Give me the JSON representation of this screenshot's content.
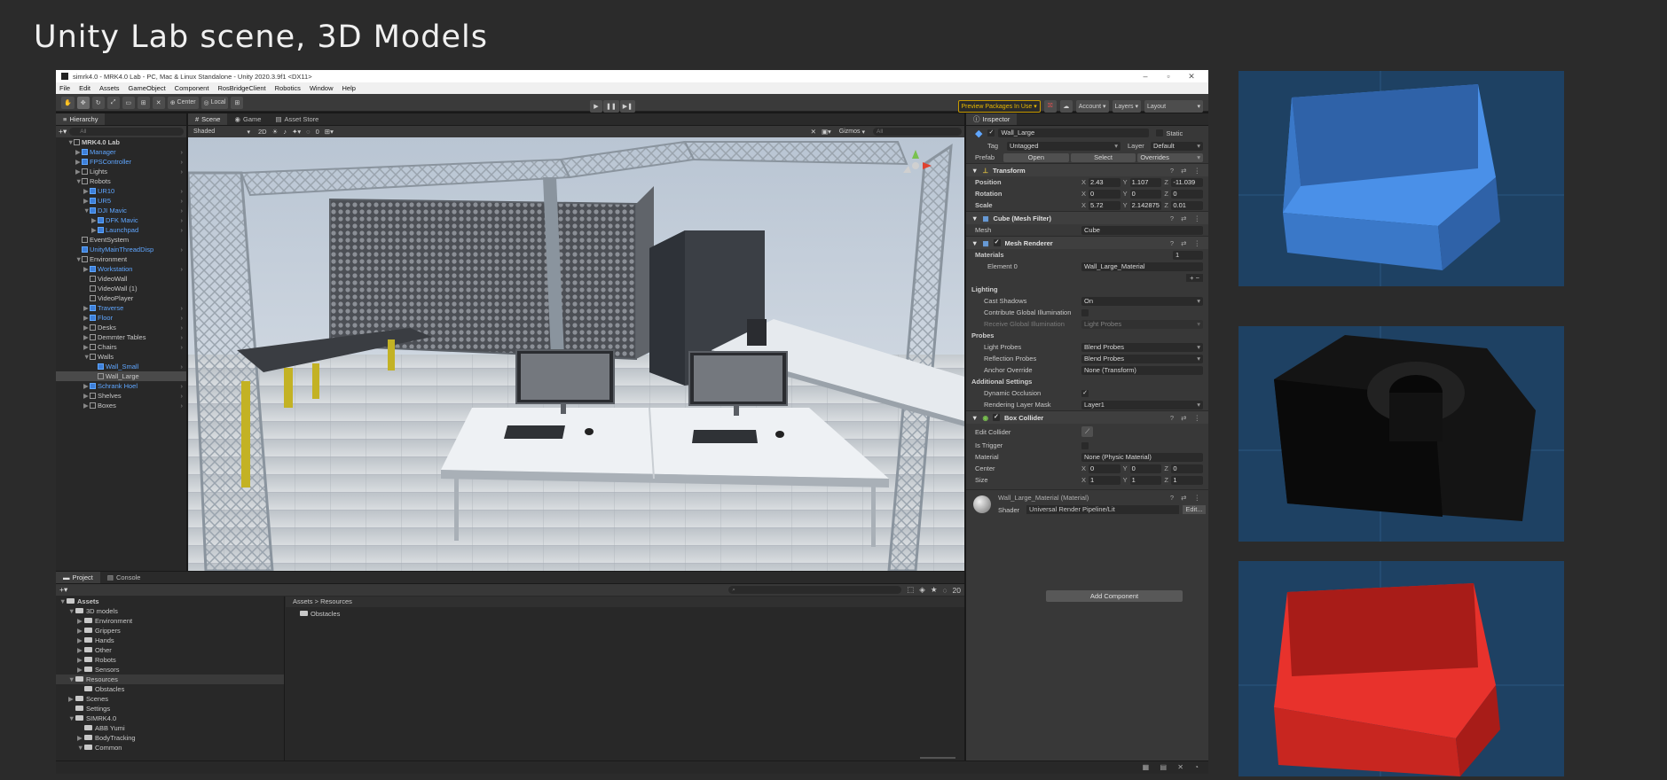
{
  "slide": {
    "title": "Unity Lab scene, 3D Models"
  },
  "unity": {
    "window_title": "simrk4.0 - MRK4.0 Lab - PC, Mac & Linux Standalone - Unity 2020.3.9f1 <DX11>",
    "menu": [
      "File",
      "Edit",
      "Assets",
      "GameObject",
      "Component",
      "RosBridgeClient",
      "Robotics",
      "Window",
      "Help"
    ],
    "toolbar": {
      "pivot": "Center",
      "space": "Local",
      "preview_packages": "Preview Packages In Use",
      "account": "Account",
      "layers": "Layers",
      "layout": "Layout"
    },
    "hierarchy": {
      "tab": "Hierarchy",
      "search_placeholder": "All",
      "items": [
        {
          "label": "MRK4.0 Lab",
          "indent": 1,
          "arrow": "▼",
          "blue": false,
          "bold": true
        },
        {
          "label": "Manager",
          "indent": 2,
          "arrow": "▶",
          "blue": true
        },
        {
          "label": "FPSController",
          "indent": 2,
          "arrow": "▶",
          "blue": true
        },
        {
          "label": "Lights",
          "indent": 2,
          "arrow": "▶",
          "blue": false
        },
        {
          "label": "Robots",
          "indent": 2,
          "arrow": "▼",
          "blue": false
        },
        {
          "label": "UR10",
          "indent": 3,
          "arrow": "▶",
          "blue": true
        },
        {
          "label": "UR5",
          "indent": 3,
          "arrow": "▶",
          "blue": true
        },
        {
          "label": "DJI Mavic",
          "indent": 3,
          "arrow": "▼",
          "blue": true
        },
        {
          "label": "DFK Mavic",
          "indent": 4,
          "arrow": "▶",
          "blue": true
        },
        {
          "label": "Launchpad",
          "indent": 4,
          "arrow": "▶",
          "blue": true
        },
        {
          "label": "EventSystem",
          "indent": 2,
          "arrow": "",
          "blue": false
        },
        {
          "label": "UnityMainThreadDisp",
          "indent": 2,
          "arrow": "",
          "blue": true
        },
        {
          "label": "Environment",
          "indent": 2,
          "arrow": "▼",
          "blue": false
        },
        {
          "label": "Workstation",
          "indent": 3,
          "arrow": "▶",
          "blue": true
        },
        {
          "label": "VideoWall",
          "indent": 3,
          "arrow": "",
          "blue": false
        },
        {
          "label": "VideoWall (1)",
          "indent": 3,
          "arrow": "",
          "blue": false
        },
        {
          "label": "VideoPlayer",
          "indent": 3,
          "arrow": "",
          "blue": false
        },
        {
          "label": "Traverse",
          "indent": 3,
          "arrow": "▶",
          "blue": true
        },
        {
          "label": "Floor",
          "indent": 3,
          "arrow": "▶",
          "blue": true
        },
        {
          "label": "Desks",
          "indent": 3,
          "arrow": "▶",
          "blue": false
        },
        {
          "label": "Demmter Tables",
          "indent": 3,
          "arrow": "▶",
          "blue": false
        },
        {
          "label": "Chairs",
          "indent": 3,
          "arrow": "▶",
          "blue": false
        },
        {
          "label": "Walls",
          "indent": 3,
          "arrow": "▼",
          "blue": false
        },
        {
          "label": "Wall_Small",
          "indent": 4,
          "arrow": "",
          "blue": true
        },
        {
          "label": "Wall_Large",
          "indent": 4,
          "arrow": "",
          "blue": false,
          "selected": true
        },
        {
          "label": "Schrank Hoel",
          "indent": 3,
          "arrow": "▶",
          "blue": true
        },
        {
          "label": "Shelves",
          "indent": 3,
          "arrow": "▶",
          "blue": false
        },
        {
          "label": "Boxes",
          "indent": 3,
          "arrow": "▶",
          "blue": false
        }
      ]
    },
    "scene": {
      "tabs": [
        "Scene",
        "Game",
        "Asset Store"
      ],
      "shading": "Shaded",
      "mode_2d": "2D",
      "gizmos": "Gizmos",
      "search_placeholder": "All",
      "hidden_count": "0"
    },
    "inspector": {
      "tab": "Inspector",
      "object_name": "Wall_Large",
      "static": "Static",
      "tag_label": "Tag",
      "tag": "Untagged",
      "layer_label": "Layer",
      "layer": "Default",
      "prefab_label": "Prefab",
      "prefab_open": "Open",
      "prefab_select": "Select",
      "prefab_overrides": "Overrides",
      "transform": {
        "title": "Transform",
        "position_label": "Position",
        "position": {
          "x": "2.43",
          "y": "1.107",
          "z": "-11.039"
        },
        "rotation_label": "Rotation",
        "rotation": {
          "x": "0",
          "y": "0",
          "z": "0"
        },
        "scale_label": "Scale",
        "scale": {
          "x": "5.72",
          "y": "2.142875",
          "z": "0.01"
        }
      },
      "mesh_filter": {
        "title": "Cube (Mesh Filter)",
        "mesh_label": "Mesh",
        "mesh": "Cube"
      },
      "mesh_renderer": {
        "title": "Mesh Renderer",
        "materials_label": "Materials",
        "materials_count": "1",
        "element0_label": "Element 0",
        "element0": "Wall_Large_Material",
        "lighting_label": "Lighting",
        "cast_shadows_label": "Cast Shadows",
        "cast_shadows": "On",
        "contribute_gi_label": "Contribute Global Illumination",
        "receive_gi_label": "Receive Global Illumination",
        "receive_gi": "Light Probes",
        "probes_label": "Probes",
        "light_probes_label": "Light Probes",
        "light_probes": "Blend Probes",
        "reflection_probes_label": "Reflection Probes",
        "reflection_probes": "Blend Probes",
        "anchor_override_label": "Anchor Override",
        "anchor_override": "None (Transform)",
        "additional_label": "Additional Settings",
        "dynamic_occlusion_label": "Dynamic Occlusion",
        "rendering_layer_label": "Rendering Layer Mask",
        "rendering_layer": "Layer1"
      },
      "box_collider": {
        "title": "Box Collider",
        "edit_label": "Edit Collider",
        "trigger_label": "Is Trigger",
        "material_label": "Material",
        "material": "None (Physic Material)",
        "center_label": "Center",
        "center": {
          "x": "0",
          "y": "0",
          "z": "0"
        },
        "size_label": "Size",
        "size": {
          "x": "1",
          "y": "1",
          "z": "1"
        }
      },
      "material": {
        "name": "Wall_Large_Material (Material)",
        "shader_label": "Shader",
        "shader": "Universal Render Pipeline/Lit",
        "edit": "Edit..."
      },
      "add_component": "Add Component"
    },
    "project": {
      "tabs": [
        "Project",
        "Console"
      ],
      "count": "20",
      "breadcrumb": [
        "Assets",
        "Resources"
      ],
      "tree": [
        {
          "label": "Assets",
          "indent": 0,
          "arrow": "▼",
          "bold": true
        },
        {
          "label": "3D models",
          "indent": 1,
          "arrow": "▼"
        },
        {
          "label": "Environment",
          "indent": 2,
          "arrow": "▶"
        },
        {
          "label": "Grippers",
          "indent": 2,
          "arrow": "▶"
        },
        {
          "label": "Hands",
          "indent": 2,
          "arrow": "▶"
        },
        {
          "label": "Other",
          "indent": 2,
          "arrow": "▶"
        },
        {
          "label": "Robots",
          "indent": 2,
          "arrow": "▶"
        },
        {
          "label": "Sensors",
          "indent": 2,
          "arrow": "▶"
        },
        {
          "label": "Resources",
          "indent": 1,
          "arrow": "▼",
          "selected": true
        },
        {
          "label": "Obstacles",
          "indent": 2,
          "arrow": ""
        },
        {
          "label": "Scenes",
          "indent": 1,
          "arrow": "▶"
        },
        {
          "label": "Settings",
          "indent": 1,
          "arrow": ""
        },
        {
          "label": "SIMRK4.0",
          "indent": 1,
          "arrow": "▼"
        },
        {
          "label": "ABB Yumi",
          "indent": 2,
          "arrow": ""
        },
        {
          "label": "BodyTracking",
          "indent": 2,
          "arrow": "▶"
        },
        {
          "label": "Common",
          "indent": 2,
          "arrow": "▼"
        }
      ],
      "files": [
        "Obstacles"
      ]
    }
  },
  "models": [
    {
      "name": "blue-crate",
      "color": "#4a90e8",
      "shade": "#3a78c8",
      "dark": "#2f62a8"
    },
    {
      "name": "black-crate",
      "color": "#141414",
      "shade": "#0a0a0a",
      "dark": "#050505"
    },
    {
      "name": "red-crate",
      "color": "#e8322c",
      "shade": "#c82620",
      "dark": "#a81c18"
    }
  ],
  "colors": {
    "background": "#2b2b2b",
    "model_bg": "#1e4163",
    "link_blue": "#5fa6ff"
  }
}
